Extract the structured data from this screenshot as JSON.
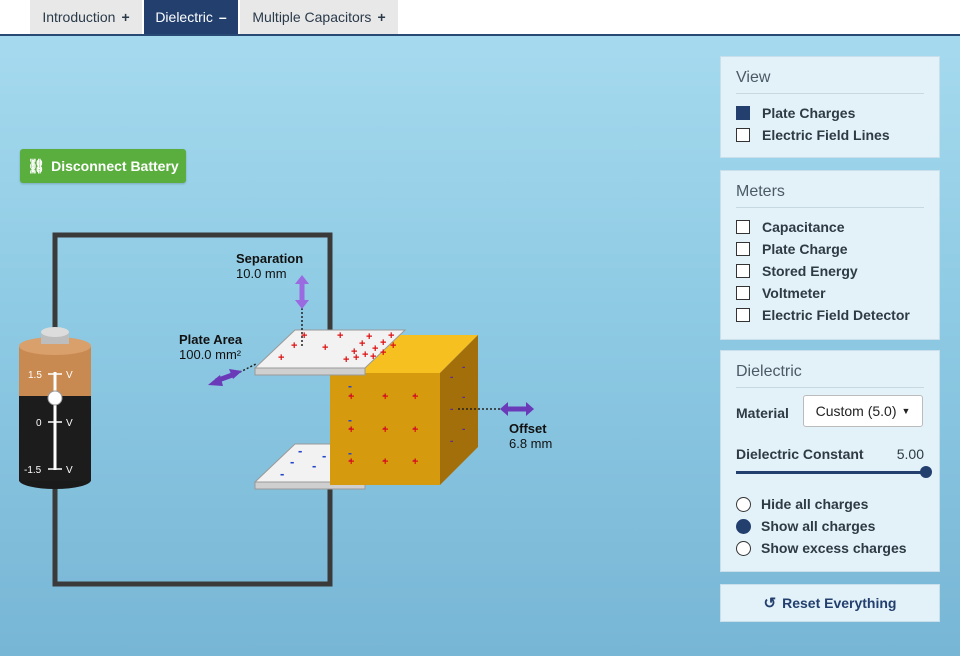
{
  "tabs": [
    {
      "label": "Introduction",
      "symbol": "+"
    },
    {
      "label": "Dielectric",
      "symbol": "–"
    },
    {
      "label": "Multiple Capacitors",
      "symbol": "+"
    }
  ],
  "battery_button": "Disconnect Battery",
  "battery": {
    "ticks": [
      "1.5",
      "0",
      "-1.5"
    ],
    "unit": "V",
    "voltage_fraction": 0.0
  },
  "labels": {
    "separation_title": "Separation",
    "separation_value": "10.0 mm",
    "area_title": "Plate Area",
    "area_value": "100.0 mm²",
    "offset_title": "Offset",
    "offset_value": "6.8 mm"
  },
  "view_panel": {
    "title": "View",
    "items": [
      {
        "label": "Plate Charges",
        "checked": true
      },
      {
        "label": "Electric Field Lines",
        "checked": false
      }
    ]
  },
  "meters_panel": {
    "title": "Meters",
    "items": [
      {
        "label": "Capacitance",
        "checked": false
      },
      {
        "label": "Plate Charge",
        "checked": false
      },
      {
        "label": "Stored Energy",
        "checked": false
      },
      {
        "label": "Voltmeter",
        "checked": false
      },
      {
        "label": "Electric Field Detector",
        "checked": false
      }
    ]
  },
  "dielectric_panel": {
    "title": "Dielectric",
    "material_label": "Material",
    "material_value": "Custom (5.0)",
    "constant_label": "Dielectric Constant",
    "constant_value": "5.00",
    "slider_fraction": 1.0,
    "radios": [
      {
        "label": "Hide all charges",
        "checked": false
      },
      {
        "label": "Show all charges",
        "checked": true
      },
      {
        "label": "Show excess charges",
        "checked": false
      }
    ]
  },
  "reset_button": "Reset Everything",
  "colors": {
    "accent": "#223f6e",
    "green": "#5aae3e",
    "dielectric": "#d59a0e"
  }
}
